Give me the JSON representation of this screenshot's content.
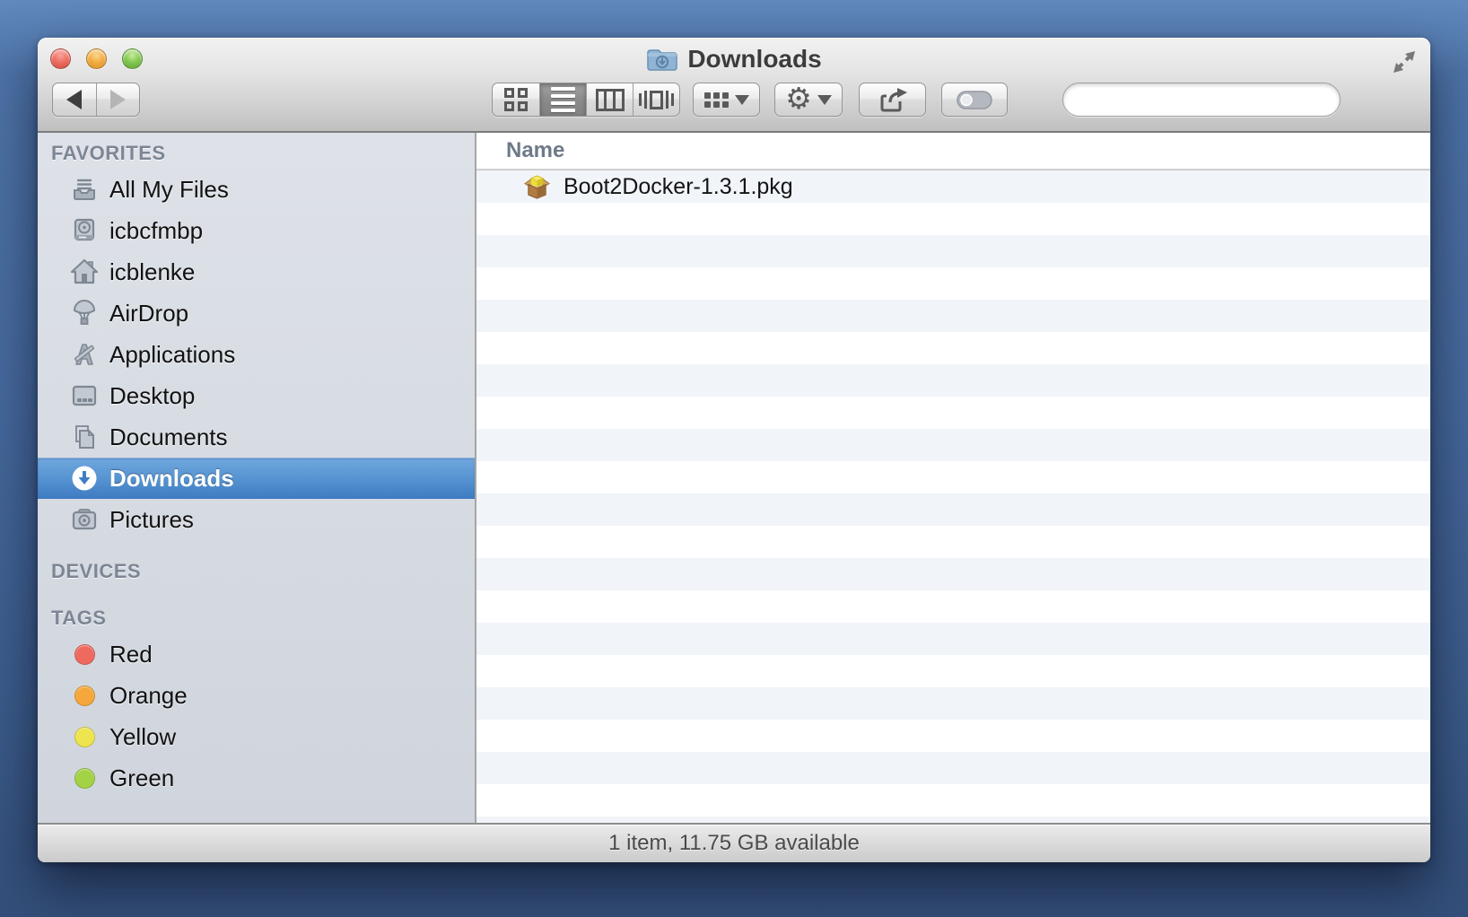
{
  "window": {
    "title": "Downloads",
    "controls": {
      "close": "close",
      "minimize": "minimize",
      "zoom": "zoom"
    }
  },
  "toolbar": {
    "view_modes": [
      "icon-view",
      "list-view",
      "column-view",
      "cover-flow-view"
    ],
    "selected_view": "list-view",
    "search": {
      "placeholder": ""
    }
  },
  "sidebar": {
    "sections": [
      {
        "label": "FAVORITES",
        "items": [
          {
            "label": "All My Files",
            "icon": "all-my-files-icon"
          },
          {
            "label": "icbcfmbp",
            "icon": "hard-drive-icon"
          },
          {
            "label": "icblenke",
            "icon": "home-icon"
          },
          {
            "label": "AirDrop",
            "icon": "airdrop-icon"
          },
          {
            "label": "Applications",
            "icon": "applications-icon"
          },
          {
            "label": "Desktop",
            "icon": "desktop-icon"
          },
          {
            "label": "Documents",
            "icon": "documents-icon"
          },
          {
            "label": "Downloads",
            "icon": "downloads-icon",
            "selected": true
          },
          {
            "label": "Pictures",
            "icon": "pictures-icon"
          }
        ]
      },
      {
        "label": "DEVICES",
        "items": []
      },
      {
        "label": "TAGS",
        "items": [
          {
            "label": "Red",
            "color": "#ee6a5f"
          },
          {
            "label": "Orange",
            "color": "#f5a73b"
          },
          {
            "label": "Yellow",
            "color": "#eee44d"
          },
          {
            "label": "Green",
            "color": "#a3d345"
          }
        ]
      }
    ]
  },
  "file_list": {
    "columns": [
      {
        "label": "Name"
      }
    ],
    "rows": [
      {
        "name": "Boot2Docker-1.3.1.pkg",
        "icon": "package-icon"
      }
    ]
  },
  "status_bar": {
    "text": "1 item, 11.75 GB available"
  },
  "colors": {
    "selection_top": "#72a8de",
    "selection_bottom": "#3e7bc1",
    "row_stripe": "#f1f4f9",
    "desktop_top": "#4d73a8",
    "desktop_bottom": "#334f7a"
  }
}
